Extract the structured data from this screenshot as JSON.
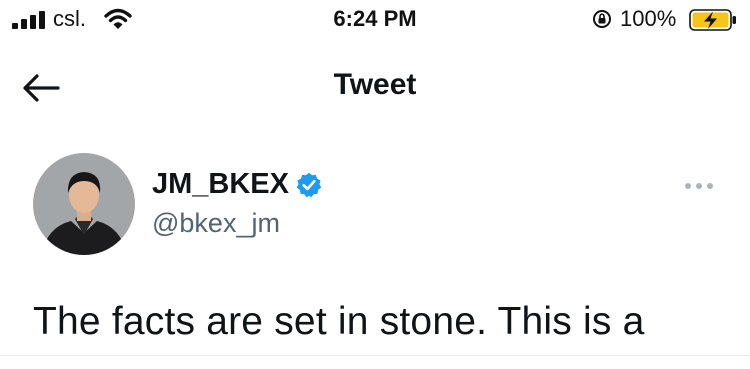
{
  "status_bar": {
    "carrier": "csl.",
    "time": "6:24 PM",
    "battery_percent": "100%",
    "signal_bars": 4,
    "battery_level": 1.0,
    "icons": [
      "signal-icon",
      "wifi-icon",
      "orientation-lock-icon",
      "battery-charging-icon"
    ]
  },
  "nav": {
    "title": "Tweet",
    "back_icon": "back-arrow-icon"
  },
  "tweet": {
    "display_name": "JM_BKEX",
    "handle": "@bkex_jm",
    "verified": true,
    "text": "The facts are set in stone. This is a",
    "more_icon": "more-options-icon"
  },
  "colors": {
    "text_primary": "#0f1419",
    "text_secondary": "#536471",
    "verified_blue": "#1d9bf0",
    "battery_yellow": "#f5c518"
  }
}
